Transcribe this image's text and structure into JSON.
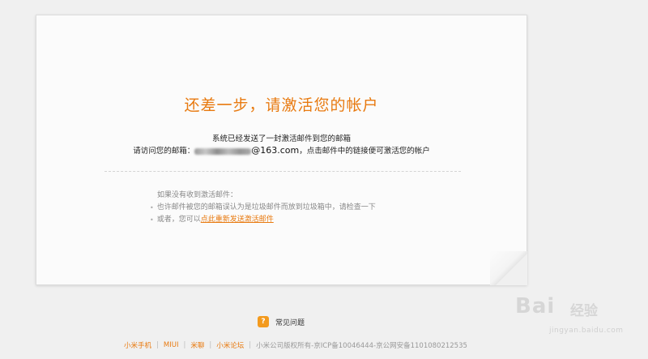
{
  "card": {
    "title": "还差一步，请激活您的帐户",
    "line1": "系统已经发送了一封激活邮件到您的邮箱",
    "line2_prefix": "请访问您的邮箱：",
    "email_domain": "@163.com",
    "line2_suffix": "，点击邮件中的链接便可激活您的帐户"
  },
  "tips": {
    "heading": "如果没有收到激活邮件：",
    "tip1": "也许邮件被您的邮箱误认为是垃圾邮件而放到垃圾箱中，请检查一下",
    "tip2_prefix": "或者，您可以",
    "resend_link": "点此重新发送激活邮件"
  },
  "faq": {
    "icon_glyph": "?",
    "label": "常见问题"
  },
  "footer": {
    "links": [
      "小米手机",
      "MIUI",
      "米聊",
      "小米论坛"
    ],
    "copyright": "小米公司版权所有-京ICP备10046444-京公网安备1101080212535"
  },
  "watermark": {
    "brand": "Bai",
    "brand2": "经验",
    "url": "jingyan.baidu.com"
  },
  "colors": {
    "accent": "#e87a10",
    "faq_icon": "#f39a1e",
    "background": "#f0f0f0",
    "card": "#fbfbfb"
  }
}
